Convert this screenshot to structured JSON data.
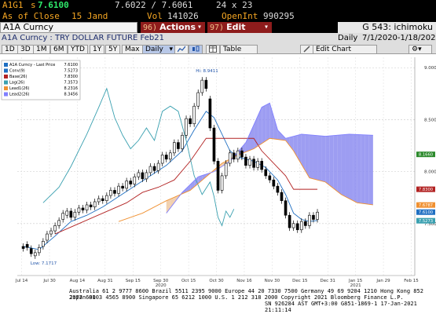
{
  "quote": {
    "ticker": "A1G1",
    "side": "s",
    "last": "7.6100",
    "bid_ask": "7.6022 / 7.6061",
    "size": "24 x 23",
    "as_of_label": "As of Close",
    "as_of_date": "15 Jand",
    "vol_label": "Vol",
    "vol_value": "141026",
    "oi_label": "OpenInt",
    "oi_value": "990295"
  },
  "menubar": {
    "security": "A1A Curncy",
    "actions_num": "96)",
    "actions_label": "Actions",
    "actions_arrow": "▾",
    "edit_num": "97)",
    "edit_label": "Edit",
    "edit_arrow": "▾",
    "function_title": "G 543: ichimoku"
  },
  "subbar": {
    "description": "A1A Curncy : TRY DOLLAR FUTURE Feb21",
    "period": "Daily",
    "date_range": "7/1/2020-1/18/2021"
  },
  "toolbar": {
    "ranges": [
      "1D",
      "3D",
      "1M",
      "6M",
      "YTD",
      "1Y",
      "5Y",
      "Max"
    ],
    "frequency": "Daily",
    "frequency_arrow": "▾",
    "table_label": "Table",
    "edit_chart_label": "Edit Chart",
    "gear_arrow": "▾"
  },
  "legend": {
    "entries": [
      {
        "name": "A1A Curncy - Last Price",
        "value": "7.6100",
        "color": "#1f6fc2"
      },
      {
        "name": "Conv(9)",
        "value": "7.5273",
        "color": "#1f6fc2"
      },
      {
        "name": "Base(26)",
        "value": "7.8300",
        "color": "#b22222"
      },
      {
        "name": "Lag(26)",
        "value": "7.3573",
        "color": "#3aa0b0"
      },
      {
        "name": "Lead1(26)",
        "value": "8.2316",
        "color": "#f09030"
      },
      {
        "name": "Lead2(26)",
        "value": "8.3456",
        "color": "#8080ff"
      }
    ]
  },
  "annotations": {
    "high": "Hi: 8.9411",
    "low": "Low: 7.1717"
  },
  "chart_data": {
    "type": "line",
    "title": "A1A Curncy : TRY DOLLAR FUTURE Feb21",
    "ylim": [
      7.0,
      9.1
    ],
    "y_ticks": [
      "9.0000",
      "8.5000",
      "8.0000",
      "7.5000"
    ],
    "x_ticks": [
      "Jul 14",
      "Jul 30",
      "Aug 14",
      "Aug 31",
      "Sep 15",
      "Sep 30",
      "Oct 15",
      "Oct 30",
      "Nov 16",
      "Nov 30",
      "Dec 15",
      "Dec 31",
      "Jan 15",
      "Jan 29",
      "Feb 15"
    ],
    "x_year_labels": [
      {
        "at": "Sep 30",
        "text": "2020"
      },
      {
        "at": "Jan 15",
        "text": "2021"
      }
    ],
    "price_labels": [
      {
        "text": "8.1660",
        "value": 8.166,
        "color": "#2c8a2c"
      },
      {
        "text": "7.8300",
        "value": 7.83,
        "color": "#b22222"
      },
      {
        "text": "7.6787",
        "value": 7.6787,
        "color": "#f09030"
      },
      {
        "text": "7.6100",
        "value": 7.61,
        "color": "#1f6fc2"
      },
      {
        "text": "7.5273",
        "value": 7.5273,
        "color": "#3aa0b0"
      }
    ],
    "candles": [
      {
        "x": 0,
        "o": 7.28,
        "c": 7.26
      },
      {
        "x": 1,
        "o": 7.3,
        "c": 7.27
      },
      {
        "x": 2,
        "o": 7.26,
        "c": 7.21
      },
      {
        "x": 3,
        "o": 7.19,
        "c": 7.22
      },
      {
        "x": 4,
        "o": 7.22,
        "c": 7.27
      },
      {
        "x": 5,
        "o": 7.28,
        "c": 7.33
      },
      {
        "x": 6,
        "o": 7.34,
        "c": 7.4
      },
      {
        "x": 7,
        "o": 7.4,
        "c": 7.43
      },
      {
        "x": 8,
        "o": 7.43,
        "c": 7.48
      },
      {
        "x": 9,
        "o": 7.48,
        "c": 7.53
      },
      {
        "x": 10,
        "o": 7.54,
        "c": 7.6
      },
      {
        "x": 11,
        "o": 7.58,
        "c": 7.62
      },
      {
        "x": 12,
        "o": 7.62,
        "c": 7.56
      },
      {
        "x": 13,
        "o": 7.56,
        "c": 7.61
      },
      {
        "x": 14,
        "o": 7.61,
        "c": 7.65
      },
      {
        "x": 15,
        "o": 7.65,
        "c": 7.63
      },
      {
        "x": 16,
        "o": 7.63,
        "c": 7.68
      },
      {
        "x": 17,
        "o": 7.68,
        "c": 7.66
      },
      {
        "x": 18,
        "o": 7.66,
        "c": 7.71
      },
      {
        "x": 19,
        "o": 7.71,
        "c": 7.74
      },
      {
        "x": 20,
        "o": 7.74,
        "c": 7.72
      },
      {
        "x": 21,
        "o": 7.72,
        "c": 7.77
      },
      {
        "x": 22,
        "o": 7.77,
        "c": 7.82
      },
      {
        "x": 23,
        "o": 7.82,
        "c": 7.79
      },
      {
        "x": 24,
        "o": 7.79,
        "c": 7.86
      },
      {
        "x": 25,
        "o": 7.86,
        "c": 7.84
      },
      {
        "x": 26,
        "o": 7.84,
        "c": 7.91
      },
      {
        "x": 27,
        "o": 7.91,
        "c": 7.88
      },
      {
        "x": 28,
        "o": 7.88,
        "c": 7.95
      },
      {
        "x": 29,
        "o": 7.95,
        "c": 7.99
      },
      {
        "x": 30,
        "o": 7.99,
        "c": 7.93
      },
      {
        "x": 31,
        "o": 7.93,
        "c": 7.99
      },
      {
        "x": 32,
        "o": 7.99,
        "c": 8.05
      },
      {
        "x": 33,
        "o": 8.05,
        "c": 8.01
      },
      {
        "x": 34,
        "o": 8.01,
        "c": 8.08
      },
      {
        "x": 35,
        "o": 8.08,
        "c": 8.16
      },
      {
        "x": 36,
        "o": 8.16,
        "c": 8.12
      },
      {
        "x": 37,
        "o": 8.12,
        "c": 8.18
      },
      {
        "x": 38,
        "o": 8.18,
        "c": 8.28
      },
      {
        "x": 39,
        "o": 8.28,
        "c": 8.22
      },
      {
        "x": 40,
        "o": 8.22,
        "c": 8.35
      },
      {
        "x": 41,
        "o": 8.35,
        "c": 8.51
      },
      {
        "x": 42,
        "o": 8.51,
        "c": 8.46
      },
      {
        "x": 43,
        "o": 8.46,
        "c": 8.63
      },
      {
        "x": 44,
        "o": 8.63,
        "c": 8.76
      },
      {
        "x": 45,
        "o": 8.76,
        "c": 8.88
      },
      {
        "x": 46,
        "o": 8.88,
        "c": 8.8
      },
      {
        "x": 47,
        "o": 8.7,
        "c": 8.42
      },
      {
        "x": 48,
        "o": 8.42,
        "c": 8.1
      },
      {
        "x": 49,
        "o": 8.1,
        "c": 7.82
      },
      {
        "x": 50,
        "o": 7.82,
        "c": 7.96
      },
      {
        "x": 51,
        "o": 7.96,
        "c": 8.08
      },
      {
        "x": 52,
        "o": 8.08,
        "c": 8.18
      },
      {
        "x": 53,
        "o": 8.18,
        "c": 8.12
      },
      {
        "x": 54,
        "o": 8.12,
        "c": 8.2
      },
      {
        "x": 55,
        "o": 8.2,
        "c": 8.14
      },
      {
        "x": 56,
        "o": 8.14,
        "c": 8.06
      },
      {
        "x": 57,
        "o": 8.06,
        "c": 8.12
      },
      {
        "x": 58,
        "o": 8.12,
        "c": 8.04
      },
      {
        "x": 59,
        "o": 8.04,
        "c": 8.1
      },
      {
        "x": 60,
        "o": 8.1,
        "c": 8.02
      },
      {
        "x": 61,
        "o": 8.02,
        "c": 7.96
      },
      {
        "x": 62,
        "o": 7.96,
        "c": 7.92
      },
      {
        "x": 63,
        "o": 7.92,
        "c": 7.86
      },
      {
        "x": 64,
        "o": 7.86,
        "c": 7.8
      },
      {
        "x": 65,
        "o": 7.8,
        "c": 7.72
      },
      {
        "x": 66,
        "o": 7.72,
        "c": 7.58
      },
      {
        "x": 67,
        "o": 7.58,
        "c": 7.46
      },
      {
        "x": 68,
        "o": 7.46,
        "c": 7.5
      },
      {
        "x": 69,
        "o": 7.5,
        "c": 7.44
      },
      {
        "x": 70,
        "o": 7.44,
        "c": 7.52
      },
      {
        "x": 71,
        "o": 7.52,
        "c": 7.48
      },
      {
        "x": 72,
        "o": 7.48,
        "c": 7.58
      },
      {
        "x": 73,
        "o": 7.58,
        "c": 7.54
      },
      {
        "x": 74,
        "o": 7.54,
        "c": 7.61
      }
    ],
    "series": [
      {
        "name": "Conv(9)",
        "color": "#1f6fc2",
        "values": [
          [
            0,
            7.28
          ],
          [
            4,
            7.25
          ],
          [
            8,
            7.38
          ],
          [
            12,
            7.52
          ],
          [
            16,
            7.58
          ],
          [
            20,
            7.66
          ],
          [
            24,
            7.76
          ],
          [
            28,
            7.86
          ],
          [
            32,
            7.96
          ],
          [
            36,
            8.06
          ],
          [
            40,
            8.2
          ],
          [
            43,
            8.4
          ],
          [
            46,
            8.58
          ],
          [
            48,
            8.52
          ],
          [
            50,
            8.36
          ],
          [
            52,
            8.2
          ],
          [
            54,
            8.14
          ],
          [
            58,
            8.1
          ],
          [
            61,
            8.04
          ],
          [
            64,
            7.92
          ],
          [
            66,
            7.78
          ],
          [
            68,
            7.6
          ],
          [
            70,
            7.54
          ],
          [
            72,
            7.52
          ],
          [
            74,
            7.53
          ]
        ]
      },
      {
        "name": "Base(26)",
        "color": "#b22222",
        "values": [
          [
            8,
            7.4
          ],
          [
            14,
            7.5
          ],
          [
            20,
            7.6
          ],
          [
            26,
            7.7
          ],
          [
            30,
            7.8
          ],
          [
            34,
            7.85
          ],
          [
            38,
            7.92
          ],
          [
            42,
            8.1
          ],
          [
            46,
            8.32
          ],
          [
            48,
            8.32
          ],
          [
            52,
            8.32
          ],
          [
            58,
            8.32
          ],
          [
            60,
            8.2
          ],
          [
            64,
            8.04
          ],
          [
            66,
            7.96
          ],
          [
            68,
            7.83
          ],
          [
            74,
            7.83
          ]
        ]
      },
      {
        "name": "Lag(26)",
        "color": "#3aa0b0",
        "values": [
          [
            5,
            7.7
          ],
          [
            9,
            7.85
          ],
          [
            12,
            8.05
          ],
          [
            16,
            8.36
          ],
          [
            19,
            8.62
          ],
          [
            21,
            8.8
          ],
          [
            23,
            8.52
          ],
          [
            25,
            8.35
          ],
          [
            27,
            8.22
          ],
          [
            29,
            8.3
          ],
          [
            31,
            8.42
          ],
          [
            33,
            8.3
          ],
          [
            35,
            8.58
          ],
          [
            37,
            8.63
          ],
          [
            39,
            8.58
          ],
          [
            41,
            8.3
          ],
          [
            43,
            7.96
          ],
          [
            45,
            7.78
          ],
          [
            47,
            7.9
          ],
          [
            48,
            7.76
          ],
          [
            49,
            7.56
          ],
          [
            50,
            7.48
          ],
          [
            51,
            7.62
          ],
          [
            52,
            7.56
          ],
          [
            53,
            7.64
          ]
        ]
      },
      {
        "name": "Lead1(26)",
        "color": "#f09030",
        "values": [
          [
            24,
            7.52
          ],
          [
            30,
            7.6
          ],
          [
            36,
            7.72
          ],
          [
            42,
            7.82
          ],
          [
            46,
            7.95
          ],
          [
            50,
            8.08
          ],
          [
            54,
            8.16
          ],
          [
            58,
            8.22
          ],
          [
            62,
            8.32
          ],
          [
            66,
            8.3
          ],
          [
            68,
            8.2
          ],
          [
            72,
            7.94
          ],
          [
            76,
            7.9
          ],
          [
            80,
            7.78
          ],
          [
            84,
            7.7
          ],
          [
            88,
            7.68
          ]
        ]
      },
      {
        "name": "Lead2(26)",
        "color": "#8080ff",
        "values": [
          [
            36,
            7.6
          ],
          [
            40,
            7.8
          ],
          [
            44,
            7.95
          ],
          [
            48,
            8.0
          ],
          [
            52,
            8.1
          ],
          [
            56,
            8.28
          ],
          [
            60,
            8.62
          ],
          [
            62,
            8.66
          ],
          [
            64,
            8.4
          ],
          [
            66,
            8.32
          ],
          [
            70,
            8.36
          ],
          [
            76,
            8.34
          ],
          [
            82,
            8.36
          ],
          [
            88,
            8.35
          ]
        ]
      }
    ]
  },
  "footer": {
    "line1": "Australia 61 2 9777 8600 Brazil 5511 2395 9000 Europe 44 20 7330 7500 Germany 49 69 9204 1210 Hong Kong 852 2977 6000",
    "line2": "Japan 81 3 4565 8900       Singapore 65 6212 1000       U.S. 1 212 318 2000        Copyright 2021 Bloomberg Finance L.P.",
    "line3": "SN 926284 AST  GMT+3:00 G851-1869-1 17-Jan-2021 21:11:14"
  }
}
